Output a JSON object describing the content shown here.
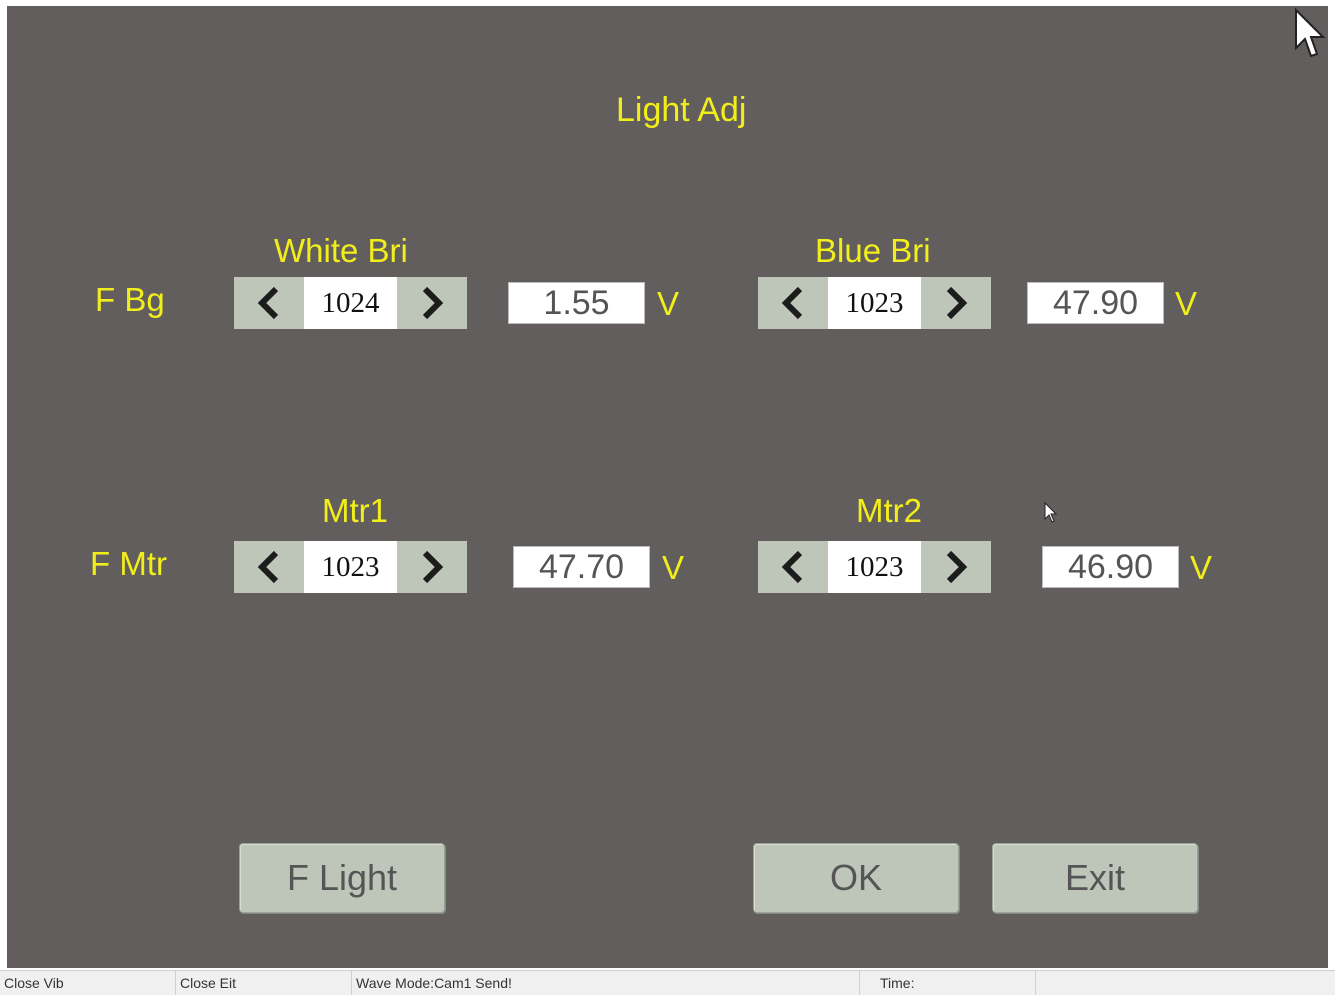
{
  "dialog": {
    "title": "Light Adj",
    "rows": [
      {
        "label": "F Bg",
        "groups": [
          {
            "label": "White Bri",
            "value": "1024",
            "voltage": "1.55",
            "unit": "V"
          },
          {
            "label": "Blue Bri",
            "value": "1023",
            "voltage": "47.90",
            "unit": "V"
          }
        ]
      },
      {
        "label": "F Mtr",
        "groups": [
          {
            "label": "Mtr1",
            "value": "1023",
            "voltage": "47.70",
            "unit": "V"
          },
          {
            "label": "Mtr2",
            "value": "1023",
            "voltage": "46.90",
            "unit": "V"
          }
        ]
      }
    ],
    "buttons": {
      "f_light": "F Light",
      "ok": "OK",
      "exit": "Exit"
    }
  },
  "statusbar": {
    "close_vib": "Close Vib",
    "close_eit": "Close Eit",
    "wave_mode": "Wave Mode:Cam1  Send!",
    "time": "Time:"
  },
  "colors": {
    "background": "#615e5d",
    "label_text": "#f2ee1c",
    "control_fill": "#bec6ba"
  }
}
